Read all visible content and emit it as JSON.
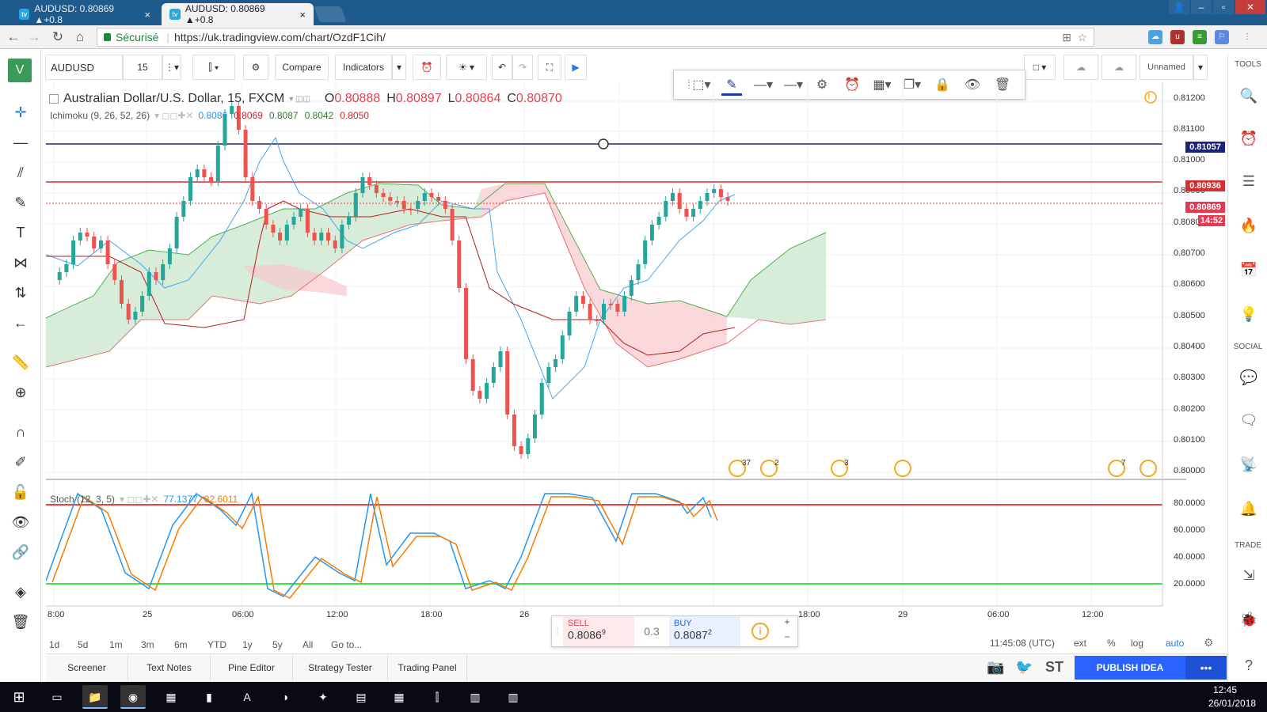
{
  "browser": {
    "tabs": [
      {
        "title": "AUDUSD: 0.80869 ▲+0.8",
        "active": false
      },
      {
        "title": "AUDUSD: 0.80869 ▲+0.8",
        "active": true
      }
    ],
    "secure_label": "Sécurisé",
    "url": "https://uk.tradingview.com/chart/OzdF1Cih/"
  },
  "toolbar": {
    "symbol": "AUDUSD",
    "interval": "15",
    "compare": "Compare",
    "indicators": "Indicators",
    "layout_name": "Unnamed"
  },
  "chart": {
    "title": "Australian Dollar/U.S. Dollar, 15, FXCM",
    "ohlc": {
      "o_label": "O",
      "o": "0.80888",
      "h_label": "H",
      "h": "0.80897",
      "l_label": "L",
      "l": "0.80864",
      "c_label": "C",
      "c": "0.80870"
    },
    "ichimoku_label": "Ichimoku (9, 26, 52, 26)",
    "ichimoku_values": [
      "0.8086",
      "0.8069",
      "0.8087",
      "0.8042",
      "0.8050"
    ],
    "stoch_label": "Stoch (12, 3, 5)",
    "stoch_values": [
      "77.1377",
      "82.6011"
    ],
    "price_axis": [
      "0.81200",
      "0.81100",
      "0.81000",
      "0.80900",
      "0.80800",
      "0.80700",
      "0.80600",
      "0.80500",
      "0.80400",
      "0.80300",
      "0.80200",
      "0.80100",
      "0.80000"
    ],
    "stoch_axis": [
      "80.0000",
      "60.0000",
      "40.0000",
      "20.0000"
    ],
    "price_labels": {
      "blue_line": "0.81057",
      "red_line": "0.80936",
      "last": "0.80869",
      "countdown": "14:52"
    },
    "time_axis": [
      "8:00",
      "25",
      "06:00",
      "12:00",
      "18:00",
      "26",
      "18:00",
      "29",
      "06:00",
      "12:00"
    ],
    "event_counts": [
      "37",
      "2",
      "3",
      "7"
    ],
    "colors": {
      "up": "#26a69a",
      "down": "#ef5350",
      "cloud_up": "#c8e6c9",
      "cloud_down": "#f8c8cc",
      "stoch_k": "#2196f3",
      "stoch_d": "#f57c00"
    }
  },
  "ranges": [
    "1d",
    "5d",
    "1m",
    "3m",
    "6m",
    "YTD",
    "1y",
    "5y",
    "All",
    "Go to..."
  ],
  "status": {
    "time": "11:45:08 (UTC)",
    "ext": "ext",
    "pct": "%",
    "log": "log",
    "auto": "auto"
  },
  "trade": {
    "sell_label": "SELL",
    "sell_price": "0.8086",
    "sell_sup": "9",
    "spread": "0.3",
    "buy_label": "BUY",
    "buy_price": "0.8087",
    "buy_sup": "2"
  },
  "bottom_tabs": [
    "Screener",
    "Text Notes",
    "Pine Editor",
    "Strategy Tester",
    "Trading Panel"
  ],
  "publish": {
    "label": "PUBLISH IDEA",
    "more": "•••",
    "st": "ST"
  },
  "sidebar": {
    "tools": "TOOLS",
    "social": "SOCIAL",
    "trade": "TRADE"
  },
  "taskbar": {
    "time": "12:45",
    "date": "26/01/2018"
  }
}
